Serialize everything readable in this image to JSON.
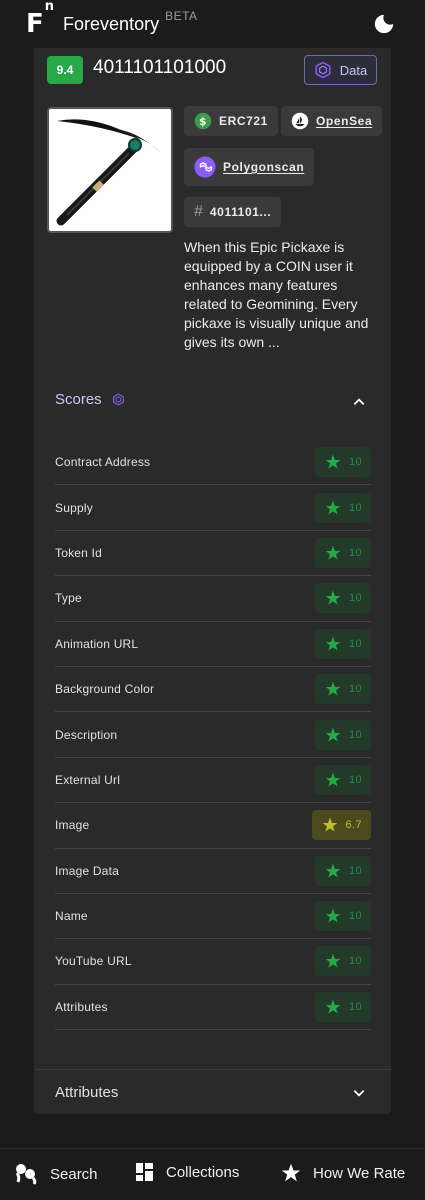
{
  "header": {
    "logo": "F",
    "logo_sup": "n",
    "brand": "Foreventory",
    "beta": "BETA",
    "theme_icon": "moon-icon"
  },
  "token": {
    "rating": "9.4",
    "title": "4011101101000",
    "data_button": "Data",
    "standard": "ERC721",
    "opensea": "OpenSea",
    "polygonscan": "Polygonscan",
    "token_id_short": "4011101...",
    "description": "When this Epic Pickaxe is equipped by a COIN user it enhances many features related to Geomining. Every pickaxe is visually unique and gives its own ..."
  },
  "scores": {
    "heading": "Scores",
    "rows": [
      {
        "label": "Contract Address",
        "value": "10"
      },
      {
        "label": "Supply",
        "value": "10"
      },
      {
        "label": "Token Id",
        "value": "10"
      },
      {
        "label": "Type",
        "value": "10"
      },
      {
        "label": "Animation URL",
        "value": "10"
      },
      {
        "label": "Background Color",
        "value": "10"
      },
      {
        "label": "Description",
        "value": "10"
      },
      {
        "label": "External Url",
        "value": "10"
      },
      {
        "label": "Image",
        "value": "6.7"
      },
      {
        "label": "Image Data",
        "value": "10"
      },
      {
        "label": "Name",
        "value": "10"
      },
      {
        "label": "YouTube URL",
        "value": "10"
      },
      {
        "label": "Attributes",
        "value": "10"
      }
    ]
  },
  "attributes": {
    "heading": "Attributes"
  },
  "nav": {
    "search": "Search",
    "collections": "Collections",
    "how_we_rate": "How We Rate"
  },
  "colors": {
    "good": "#27a94a",
    "mid": "#bcbf33",
    "accent": "#8b5cf6"
  }
}
